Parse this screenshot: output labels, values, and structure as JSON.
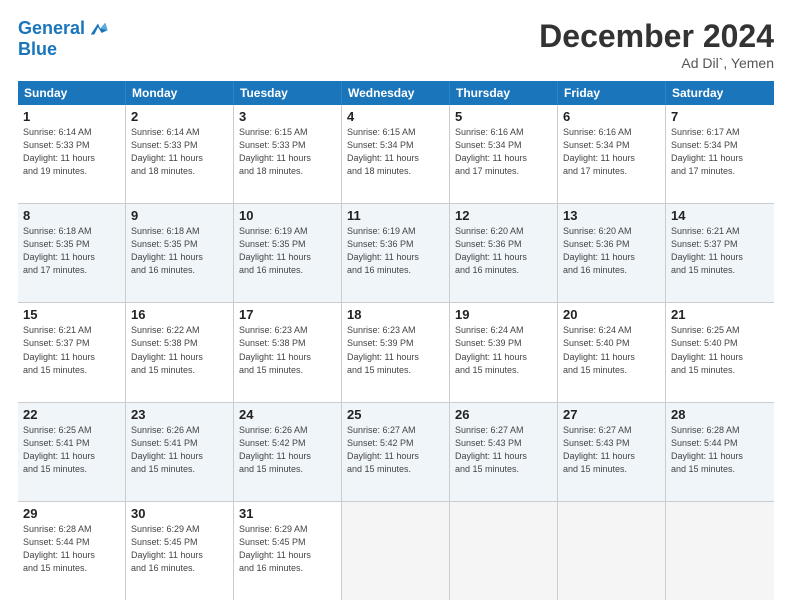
{
  "header": {
    "logo_line1": "General",
    "logo_line2": "Blue",
    "month_title": "December 2024",
    "subtitle": "Ad Dil`, Yemen"
  },
  "weekdays": [
    "Sunday",
    "Monday",
    "Tuesday",
    "Wednesday",
    "Thursday",
    "Friday",
    "Saturday"
  ],
  "rows": [
    [
      {
        "day": "1",
        "info": "Sunrise: 6:14 AM\nSunset: 5:33 PM\nDaylight: 11 hours\nand 19 minutes."
      },
      {
        "day": "2",
        "info": "Sunrise: 6:14 AM\nSunset: 5:33 PM\nDaylight: 11 hours\nand 18 minutes."
      },
      {
        "day": "3",
        "info": "Sunrise: 6:15 AM\nSunset: 5:33 PM\nDaylight: 11 hours\nand 18 minutes."
      },
      {
        "day": "4",
        "info": "Sunrise: 6:15 AM\nSunset: 5:34 PM\nDaylight: 11 hours\nand 18 minutes."
      },
      {
        "day": "5",
        "info": "Sunrise: 6:16 AM\nSunset: 5:34 PM\nDaylight: 11 hours\nand 17 minutes."
      },
      {
        "day": "6",
        "info": "Sunrise: 6:16 AM\nSunset: 5:34 PM\nDaylight: 11 hours\nand 17 minutes."
      },
      {
        "day": "7",
        "info": "Sunrise: 6:17 AM\nSunset: 5:34 PM\nDaylight: 11 hours\nand 17 minutes."
      }
    ],
    [
      {
        "day": "8",
        "info": "Sunrise: 6:18 AM\nSunset: 5:35 PM\nDaylight: 11 hours\nand 17 minutes."
      },
      {
        "day": "9",
        "info": "Sunrise: 6:18 AM\nSunset: 5:35 PM\nDaylight: 11 hours\nand 16 minutes."
      },
      {
        "day": "10",
        "info": "Sunrise: 6:19 AM\nSunset: 5:35 PM\nDaylight: 11 hours\nand 16 minutes."
      },
      {
        "day": "11",
        "info": "Sunrise: 6:19 AM\nSunset: 5:36 PM\nDaylight: 11 hours\nand 16 minutes."
      },
      {
        "day": "12",
        "info": "Sunrise: 6:20 AM\nSunset: 5:36 PM\nDaylight: 11 hours\nand 16 minutes."
      },
      {
        "day": "13",
        "info": "Sunrise: 6:20 AM\nSunset: 5:36 PM\nDaylight: 11 hours\nand 16 minutes."
      },
      {
        "day": "14",
        "info": "Sunrise: 6:21 AM\nSunset: 5:37 PM\nDaylight: 11 hours\nand 15 minutes."
      }
    ],
    [
      {
        "day": "15",
        "info": "Sunrise: 6:21 AM\nSunset: 5:37 PM\nDaylight: 11 hours\nand 15 minutes."
      },
      {
        "day": "16",
        "info": "Sunrise: 6:22 AM\nSunset: 5:38 PM\nDaylight: 11 hours\nand 15 minutes."
      },
      {
        "day": "17",
        "info": "Sunrise: 6:23 AM\nSunset: 5:38 PM\nDaylight: 11 hours\nand 15 minutes."
      },
      {
        "day": "18",
        "info": "Sunrise: 6:23 AM\nSunset: 5:39 PM\nDaylight: 11 hours\nand 15 minutes."
      },
      {
        "day": "19",
        "info": "Sunrise: 6:24 AM\nSunset: 5:39 PM\nDaylight: 11 hours\nand 15 minutes."
      },
      {
        "day": "20",
        "info": "Sunrise: 6:24 AM\nSunset: 5:40 PM\nDaylight: 11 hours\nand 15 minutes."
      },
      {
        "day": "21",
        "info": "Sunrise: 6:25 AM\nSunset: 5:40 PM\nDaylight: 11 hours\nand 15 minutes."
      }
    ],
    [
      {
        "day": "22",
        "info": "Sunrise: 6:25 AM\nSunset: 5:41 PM\nDaylight: 11 hours\nand 15 minutes."
      },
      {
        "day": "23",
        "info": "Sunrise: 6:26 AM\nSunset: 5:41 PM\nDaylight: 11 hours\nand 15 minutes."
      },
      {
        "day": "24",
        "info": "Sunrise: 6:26 AM\nSunset: 5:42 PM\nDaylight: 11 hours\nand 15 minutes."
      },
      {
        "day": "25",
        "info": "Sunrise: 6:27 AM\nSunset: 5:42 PM\nDaylight: 11 hours\nand 15 minutes."
      },
      {
        "day": "26",
        "info": "Sunrise: 6:27 AM\nSunset: 5:43 PM\nDaylight: 11 hours\nand 15 minutes."
      },
      {
        "day": "27",
        "info": "Sunrise: 6:27 AM\nSunset: 5:43 PM\nDaylight: 11 hours\nand 15 minutes."
      },
      {
        "day": "28",
        "info": "Sunrise: 6:28 AM\nSunset: 5:44 PM\nDaylight: 11 hours\nand 15 minutes."
      }
    ],
    [
      {
        "day": "29",
        "info": "Sunrise: 6:28 AM\nSunset: 5:44 PM\nDaylight: 11 hours\nand 15 minutes."
      },
      {
        "day": "30",
        "info": "Sunrise: 6:29 AM\nSunset: 5:45 PM\nDaylight: 11 hours\nand 16 minutes."
      },
      {
        "day": "31",
        "info": "Sunrise: 6:29 AM\nSunset: 5:45 PM\nDaylight: 11 hours\nand 16 minutes."
      },
      {
        "day": "",
        "info": ""
      },
      {
        "day": "",
        "info": ""
      },
      {
        "day": "",
        "info": ""
      },
      {
        "day": "",
        "info": ""
      }
    ]
  ]
}
